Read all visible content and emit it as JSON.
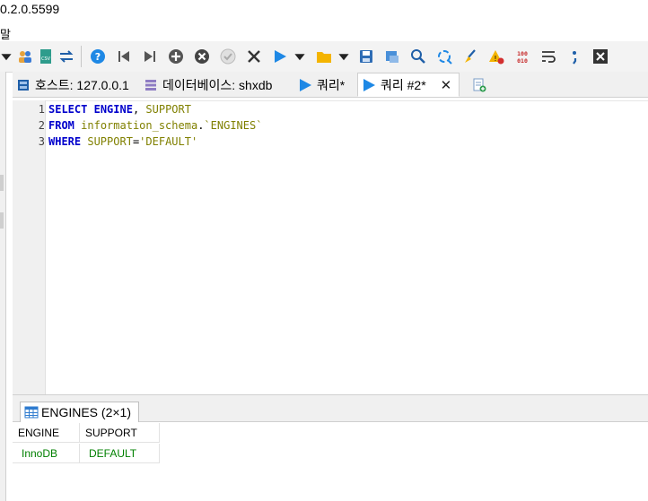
{
  "window": {
    "title_fragment": "0.2.0.5599",
    "menu_fragment": "말"
  },
  "toolbar": {
    "icons": [
      "dropdown-arrow-icon",
      "user-manager-icon",
      "export-csv-icon",
      "sync-icon",
      "help-icon",
      "first-record-icon",
      "last-record-icon",
      "add-record-icon",
      "delete-record-icon",
      "post-record-icon",
      "cancel-record-icon",
      "run-icon",
      "run-dropdown-icon",
      "open-folder-icon",
      "open-dropdown-icon",
      "save-icon",
      "save-as-icon",
      "find-icon",
      "replace-icon",
      "format-sql-icon",
      "warnings-icon",
      "binary-icon",
      "wrap-icon",
      "semicolon-icon",
      "close-tab-icon"
    ]
  },
  "tabs": [
    {
      "label": "호스트: 127.0.0.1",
      "icon": "host-icon"
    },
    {
      "label": "데이터베이스: shxdb",
      "icon": "database-icon"
    },
    {
      "label": "쿼리*",
      "icon": "query-icon"
    },
    {
      "label": "쿼리 #2*",
      "icon": "query-icon",
      "active": true,
      "close": "✕"
    },
    {
      "label": "",
      "icon": "new-query-tab-icon"
    }
  ],
  "editor": {
    "line_numbers": [
      "1",
      "2",
      "3"
    ],
    "line1": {
      "kw1": "SELECT",
      "id1": "ENGINE",
      "sep": ", ",
      "id2": "SUPPORT"
    },
    "line2": {
      "kw1": "FROM",
      "id1": "information_schema",
      "dot": ".",
      "id2": "`ENGINES`"
    },
    "line3": {
      "kw1": "WHERE",
      "id1": "SUPPORT",
      "op": "=",
      "str": "'DEFAULT'"
    }
  },
  "result": {
    "tab_label": "ENGINES (2×1)",
    "columns": [
      "ENGINE",
      "SUPPORT"
    ],
    "rows": [
      [
        "InnoDB",
        "DEFAULT"
      ]
    ]
  },
  "colors": {
    "keyword": "#0000cc",
    "identifier": "#808000",
    "result_value": "#008000",
    "run_blue": "#1e88e5"
  }
}
